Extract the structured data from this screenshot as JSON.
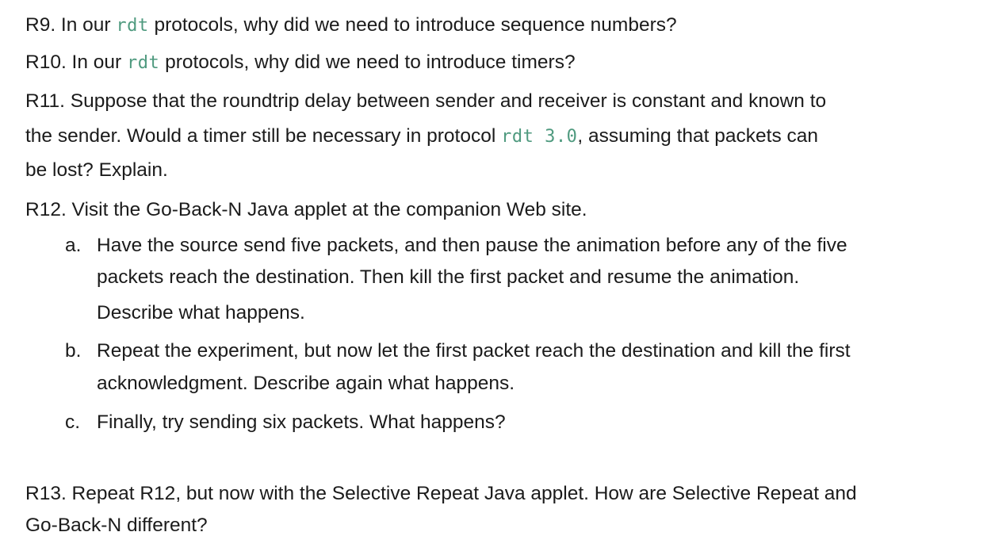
{
  "r9": {
    "pre": "R9. In our ",
    "code": "rdt",
    "post": " protocols, why did we need to introduce sequence numbers?"
  },
  "r10": {
    "pre": "R10. In our ",
    "code": "rdt",
    "post": " protocols, why did we need to introduce timers?"
  },
  "r11": {
    "line1": "R11. Suppose that the roundtrip delay between sender and receiver is constant and known to",
    "line2_pre": "the sender. Would a timer still be necessary in protocol ",
    "line2_code": "rdt 3.0",
    "line2_post": ", assuming that packets can",
    "line3": "be lost? Explain."
  },
  "r12": {
    "intro": "R12. Visit the Go-Back-N Java applet at the companion Web site.",
    "items": [
      {
        "marker": "a.",
        "lines": [
          "Have the source send five packets, and then pause the animation before any of the five",
          "packets reach the destination. Then kill the first packet and resume the animation.",
          "Describe what happens."
        ]
      },
      {
        "marker": "b.",
        "lines": [
          "Repeat the experiment, but now let the first packet reach the destination and kill the first",
          "acknowledgment. Describe again what happens."
        ]
      },
      {
        "marker": "c.",
        "lines": [
          "Finally, try sending six packets. What happens?"
        ]
      }
    ]
  },
  "r13": {
    "line1": "R13. Repeat R12, but now with the Selective Repeat Java applet. How are Selective Repeat and",
    "line2": "Go-Back-N different?"
  }
}
